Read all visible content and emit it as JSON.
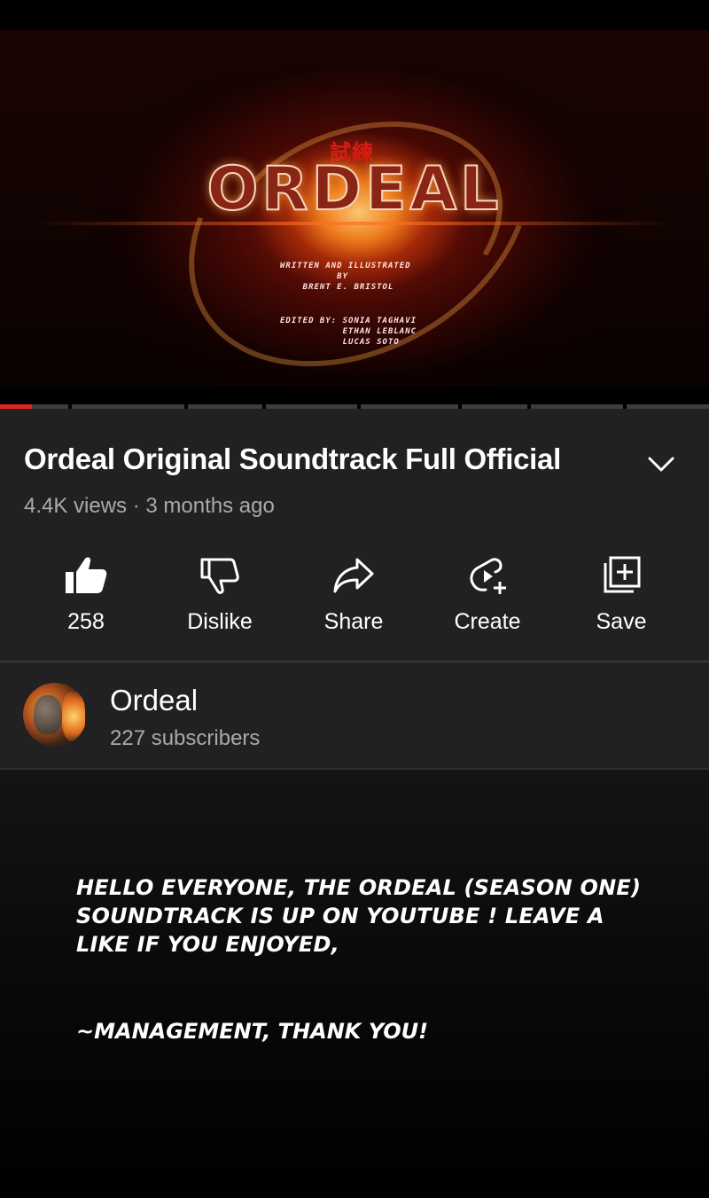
{
  "video": {
    "thumbnail": {
      "kanji": "試練",
      "logo_text": "ORDEAL",
      "credits_written": "WRITTEN AND ILLUSTRATED\n          BY\n    BRENT E. BRISTOL",
      "credits_edited": "EDITED BY: SONIA TAGHAVI\n           ETHAN LEBLANC\n           LUCAS SOTO"
    },
    "progress": {
      "played_fraction": 0.045,
      "buffered_fraction": 0.045
    }
  },
  "info": {
    "title": "Ordeal Original Soundtrack Full Official",
    "meta": "4.4K views · 3 months ago",
    "actions": [
      {
        "label": "258",
        "icon": "thumbs-up-filled-icon"
      },
      {
        "label": "Dislike",
        "icon": "thumbs-down-icon"
      },
      {
        "label": "Share",
        "icon": "share-arrow-icon"
      },
      {
        "label": "Create",
        "icon": "create-clip-icon"
      },
      {
        "label": "Save",
        "icon": "save-playlist-icon"
      }
    ]
  },
  "channel": {
    "name": "Ordeal",
    "subscribers": "227 subscribers"
  },
  "overlay": {
    "message": "Hello everyone, the Ordeal (season one) soundtrack is up on youtube ! Leave a like if you enjoyed,",
    "signoff": "~Management, thank you!"
  },
  "colors": {
    "panel_bg": "#212121",
    "secondary_text": "#aaaaaa",
    "progress_played": "#e22222"
  }
}
